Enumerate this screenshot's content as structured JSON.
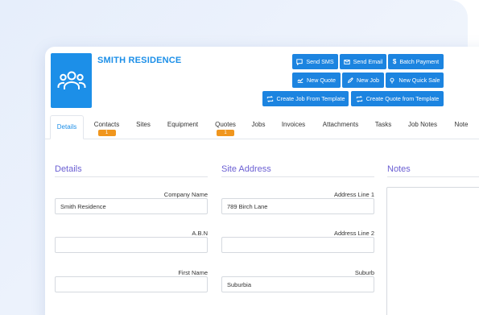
{
  "header": {
    "title": "SMITH RESIDENCE"
  },
  "actions": {
    "send_sms": "Send SMS",
    "send_email": "Send Email",
    "batch_payment": "Batch Payment",
    "new_quote": "New Quote",
    "new_job": "New Job",
    "new_quick_sale": "New Quick Sale",
    "create_job_from_template": "Create Job From Template",
    "create_quote_from_template": "Create Quote from Template"
  },
  "tabs": [
    {
      "label": "Details",
      "active": true
    },
    {
      "label": "Contacts",
      "badge": "1"
    },
    {
      "label": "Sites"
    },
    {
      "label": "Equipment"
    },
    {
      "label": "Quotes",
      "badge": "1"
    },
    {
      "label": "Jobs"
    },
    {
      "label": "Invoices"
    },
    {
      "label": "Attachments"
    },
    {
      "label": "Tasks"
    },
    {
      "label": "Job Notes"
    },
    {
      "label": "Note"
    }
  ],
  "details": {
    "heading": "Details",
    "company_name_label": "Company Name",
    "company_name_value": "Smith Residence",
    "abn_label": "A.B.N",
    "abn_value": "",
    "first_name_label": "First Name",
    "first_name_value": ""
  },
  "site_address": {
    "heading": "Site Address",
    "address1_label": "Address Line 1",
    "address1_value": "789 Birch Lane",
    "address2_label": "Address Line 2",
    "address2_value": "",
    "suburb_label": "Suburb",
    "suburb_value": "Suburbia"
  },
  "notes": {
    "heading": "Notes"
  },
  "colors": {
    "accent": "#1c8fe8",
    "button": "#1c84e0",
    "badge": "#f0961e",
    "section_title": "#6b5fd3"
  }
}
